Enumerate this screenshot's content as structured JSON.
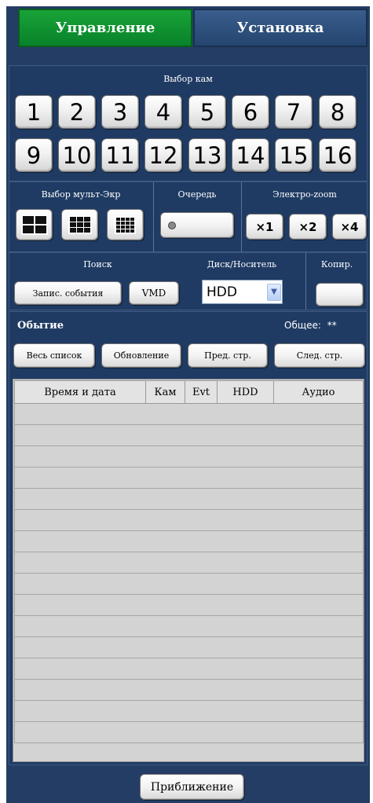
{
  "tabs": {
    "active": "Управление",
    "inactive": "Установка"
  },
  "camera_select": {
    "label": "Выбор кам",
    "buttons": [
      "1",
      "2",
      "3",
      "4",
      "5",
      "6",
      "7",
      "8",
      "9",
      "10",
      "11",
      "12",
      "13",
      "14",
      "15",
      "16"
    ]
  },
  "multiscreen": {
    "label": "Выбор мульт-Экр",
    "layouts": [
      "quad-grid-icon",
      "nine-grid-icon",
      "sixteen-grid-icon"
    ]
  },
  "sequence": {
    "label": "Очередь"
  },
  "ezoom": {
    "label": "Электро-zoom",
    "buttons": [
      "×1",
      "×2",
      "×4"
    ]
  },
  "search": {
    "label": "Поиск",
    "event_button": "Запис. события",
    "vmd_button": "VMD"
  },
  "disk": {
    "label": "Диск/Носитель",
    "selected": "HDD"
  },
  "copy": {
    "label": "Копир."
  },
  "events": {
    "title": "Обытие",
    "total_label": "Общее:",
    "total_value": "**",
    "buttons": {
      "all": "Весь список",
      "refresh": "Обновление",
      "prev": "Пред. стр.",
      "next": "След. стр."
    },
    "columns": [
      "Время и дата",
      "Кам",
      "Evt",
      "HDD",
      "Аудио"
    ],
    "rows": 16
  },
  "zoom_button": "Приближение"
}
